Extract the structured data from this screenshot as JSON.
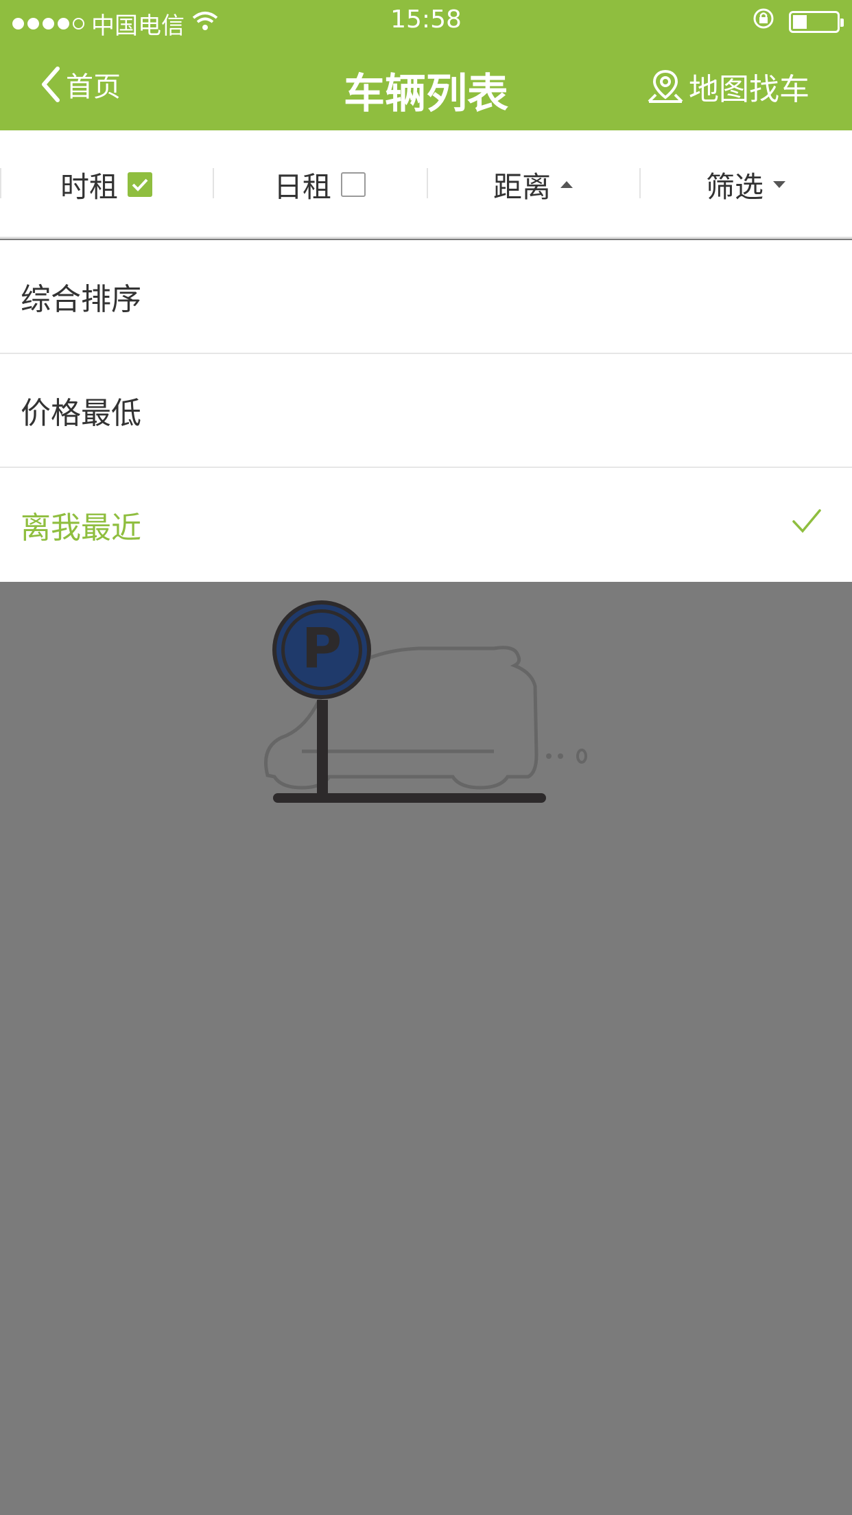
{
  "status_bar": {
    "carrier": "中国电信",
    "time": "15:58"
  },
  "nav": {
    "back_label": "首页",
    "title": "车辆列表",
    "map_label": "地图找车"
  },
  "filters": [
    {
      "label": "时租",
      "checked": true
    },
    {
      "label": "日租",
      "checked": false
    },
    {
      "label": "距离",
      "indicator": "triangle-up"
    },
    {
      "label": "筛选",
      "indicator": "triangle-down"
    }
  ],
  "sort_options": [
    {
      "label": "综合排序",
      "selected": false
    },
    {
      "label": "价格最低",
      "selected": false
    },
    {
      "label": "离我最近",
      "selected": true
    }
  ],
  "colors": {
    "brand": "#8fbe3f",
    "overlay": "#7b7b7b",
    "parking_sign": "#1f3a6b"
  }
}
